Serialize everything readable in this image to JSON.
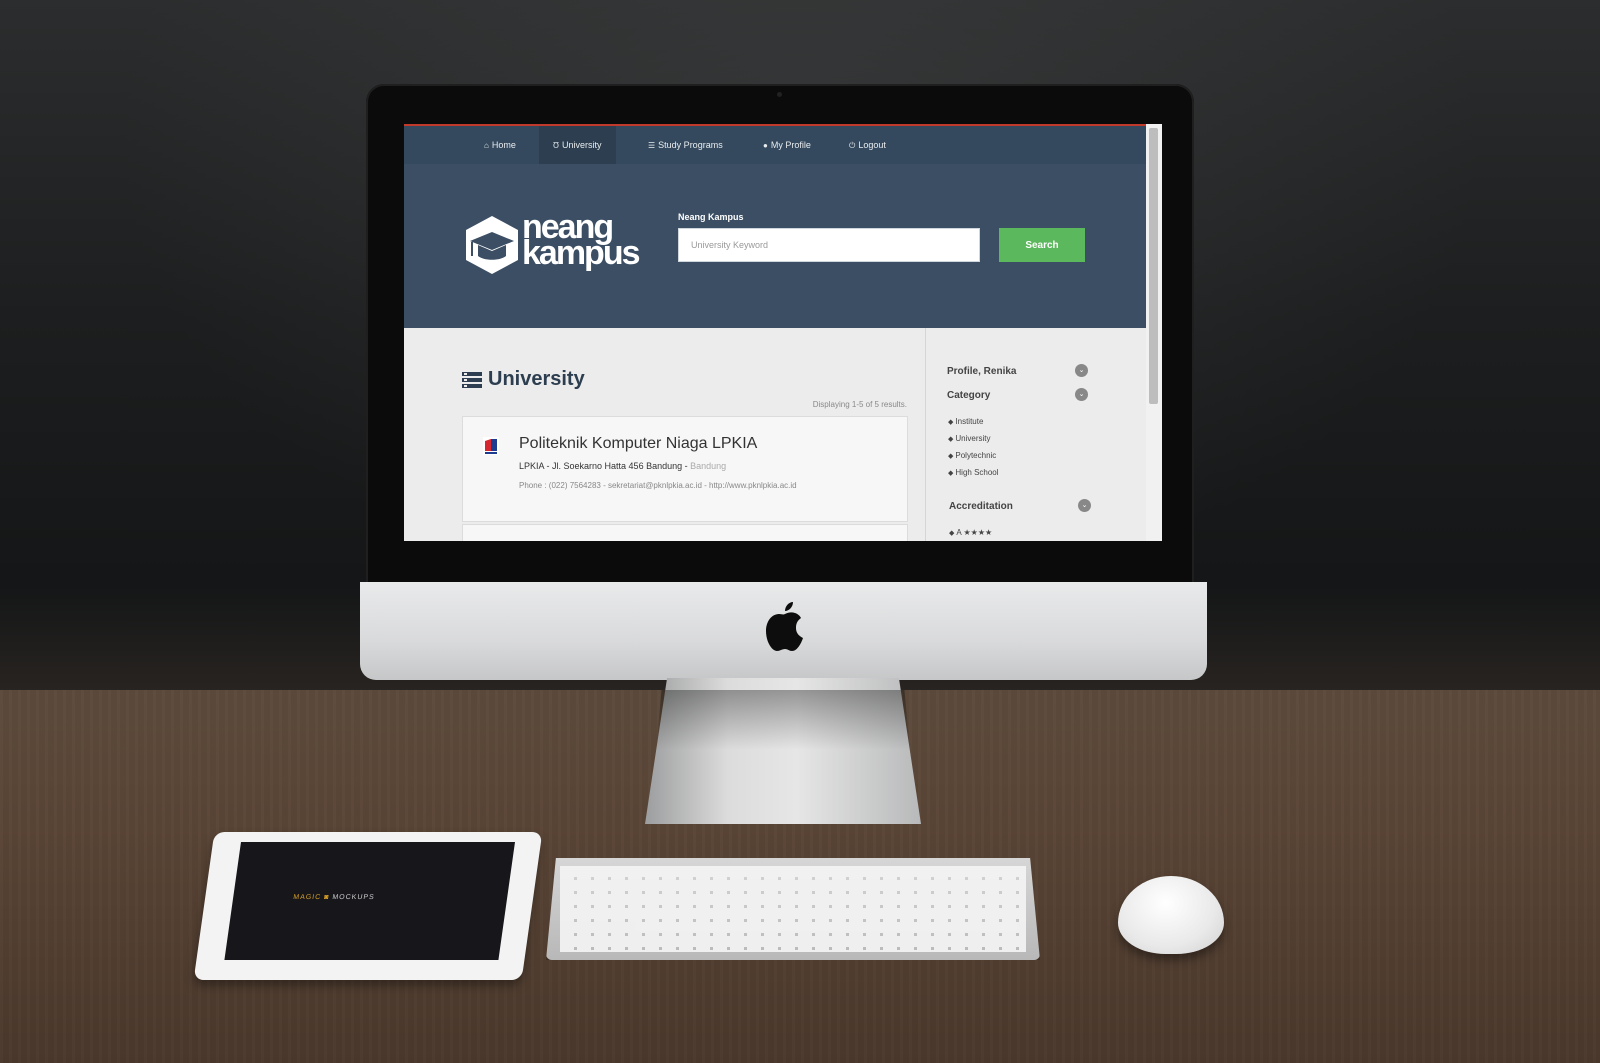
{
  "nav": {
    "items": [
      {
        "label": "Home",
        "icon": "home-icon",
        "active": false
      },
      {
        "label": "University",
        "icon": "university-icon",
        "active": true
      },
      {
        "label": "Study Programs",
        "icon": "list-icon",
        "active": false
      },
      {
        "label": "My Profile",
        "icon": "user-icon",
        "active": false
      },
      {
        "label": "Logout",
        "icon": "power-icon",
        "active": false
      }
    ]
  },
  "hero": {
    "logo_line1": "neang",
    "logo_line2": "kampus",
    "search_label": "Neang Kampus",
    "search_placeholder": "University Keyword",
    "search_value": "",
    "search_button": "Search"
  },
  "main": {
    "title": "University",
    "displaying": "Displaying 1-5 of 5 results.",
    "results": [
      {
        "name": "Politeknik Komputer Niaga LPKIA",
        "address": "LPKIA - Jl. Soekarno Hatta 456 Bandung - ",
        "city": "Bandung",
        "contact": "Phone : (022) 7564283 - sekretariat@pknlpkia.ac.id - http://www.pknlpkia.ac.id"
      }
    ]
  },
  "sidebar": {
    "profile": "Profile, Renika",
    "category": "Category",
    "categories": [
      "Institute",
      "University",
      "Polytechnic",
      "High School"
    ],
    "accreditation": "Accreditation",
    "accreditation_item": "A ★★★★"
  },
  "ipad": {
    "brand_1": "MAGIC",
    "brand_2": "MOCKUPS"
  },
  "colors": {
    "nav_bg": "#34495e",
    "hero_bg": "#3b4e64",
    "search_button": "#5cb85c",
    "accent_line": "#c0392b"
  }
}
